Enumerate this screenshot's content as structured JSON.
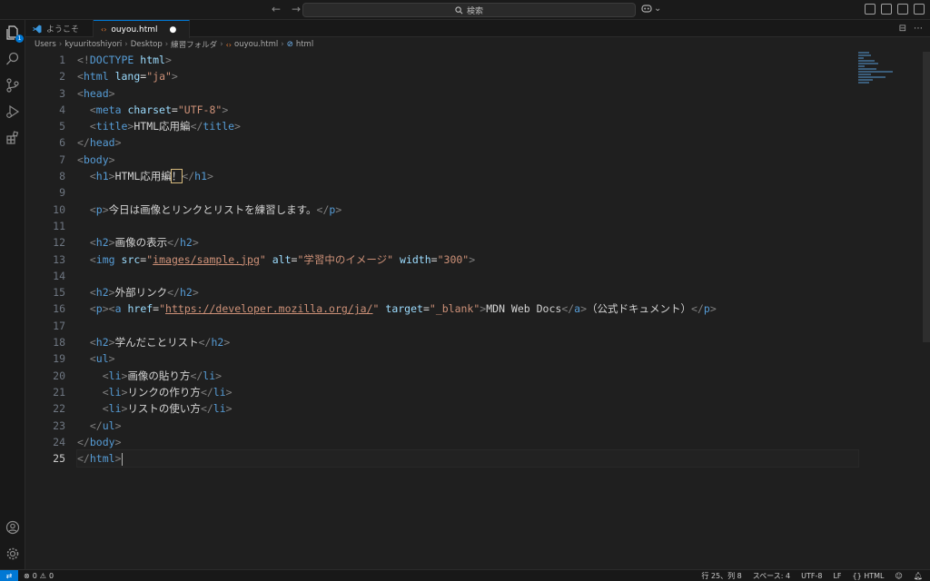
{
  "titlebar": {
    "search_placeholder": "検索",
    "back_icon": "arrow-left-icon",
    "forward_icon": "arrow-right-icon"
  },
  "activity_bar": {
    "explorer_badge": "1",
    "items": [
      "explorer-icon",
      "search-icon",
      "source-control-icon",
      "run-debug-icon",
      "extensions-icon"
    ],
    "bottom": [
      "account-icon",
      "settings-gear-icon"
    ]
  },
  "tabs": [
    {
      "label": "ようこそ",
      "icon": "vscode-logo-icon",
      "active": false
    },
    {
      "label": "ouyou.html",
      "icon": "html-file-icon",
      "active": true,
      "modified": true
    }
  ],
  "breadcrumb": [
    "Users",
    "kyuuritoshiyori",
    "Desktop",
    "練習フォルダ",
    "ouyou.html",
    "html"
  ],
  "editor": {
    "current_line": 25,
    "lines": [
      {
        "n": "1"
      },
      {
        "n": "2"
      },
      {
        "n": "3"
      },
      {
        "n": "4"
      },
      {
        "n": "5"
      },
      {
        "n": "6"
      },
      {
        "n": "7"
      },
      {
        "n": "8"
      },
      {
        "n": "9"
      },
      {
        "n": "10"
      },
      {
        "n": "11"
      },
      {
        "n": "12"
      },
      {
        "n": "13"
      },
      {
        "n": "14"
      },
      {
        "n": "15"
      },
      {
        "n": "16"
      },
      {
        "n": "17"
      },
      {
        "n": "18"
      },
      {
        "n": "19"
      },
      {
        "n": "20"
      },
      {
        "n": "21"
      },
      {
        "n": "22"
      },
      {
        "n": "23"
      },
      {
        "n": "24"
      },
      {
        "n": "25"
      }
    ],
    "text": {
      "doctype": "DOCTYPE",
      "html_kw": "html",
      "lang_attr": "lang",
      "lang_val": "\"ja\"",
      "head": "head",
      "meta": "meta",
      "charset_attr": "charset",
      "charset_val": "\"UTF-8\"",
      "title": "title",
      "title_text": "HTML応用編",
      "body": "body",
      "h1": "h1",
      "h1_text": "HTML応用編",
      "h1_mark": "！",
      "p": "p",
      "p_text": "今日は画像とリンクとリストを練習します。",
      "h2": "h2",
      "h2_image": "画像の表示",
      "img": "img",
      "src_attr": "src",
      "src_val": "images/sample.jpg",
      "alt_attr": "alt",
      "alt_val": "\"学習中のイメージ\"",
      "width_attr": "width",
      "width_val": "\"300\"",
      "h2_link": "外部リンク",
      "a": "a",
      "href_attr": "href",
      "href_val": "https://developer.mozilla.org/ja/",
      "target_attr": "target",
      "target_val": "\"_blank\"",
      "a_text": "MDN Web Docs",
      "a_after": "（公式ドキュメント）",
      "h2_learned": "学んだことリスト",
      "ul": "ul",
      "li": "li",
      "li1": "画像の貼り方",
      "li2": "リンクの作り方",
      "li3": "リストの使い方"
    }
  },
  "statusbar": {
    "errors": "0",
    "warnings": "0",
    "position": "行 25、列 8",
    "indent": "スペース: 4",
    "encoding": "UTF-8",
    "eol": "LF",
    "language": "HTML",
    "language_icon": "braces-icon",
    "copilot_icon": "copilot-icon",
    "bell_icon": "bell-icon"
  },
  "colors": {
    "tag": "#569cd6",
    "attr_name": "#9cdcfe",
    "attr_value": "#ce9178",
    "accent": "#0078d4",
    "background": "#1f1f1f"
  }
}
